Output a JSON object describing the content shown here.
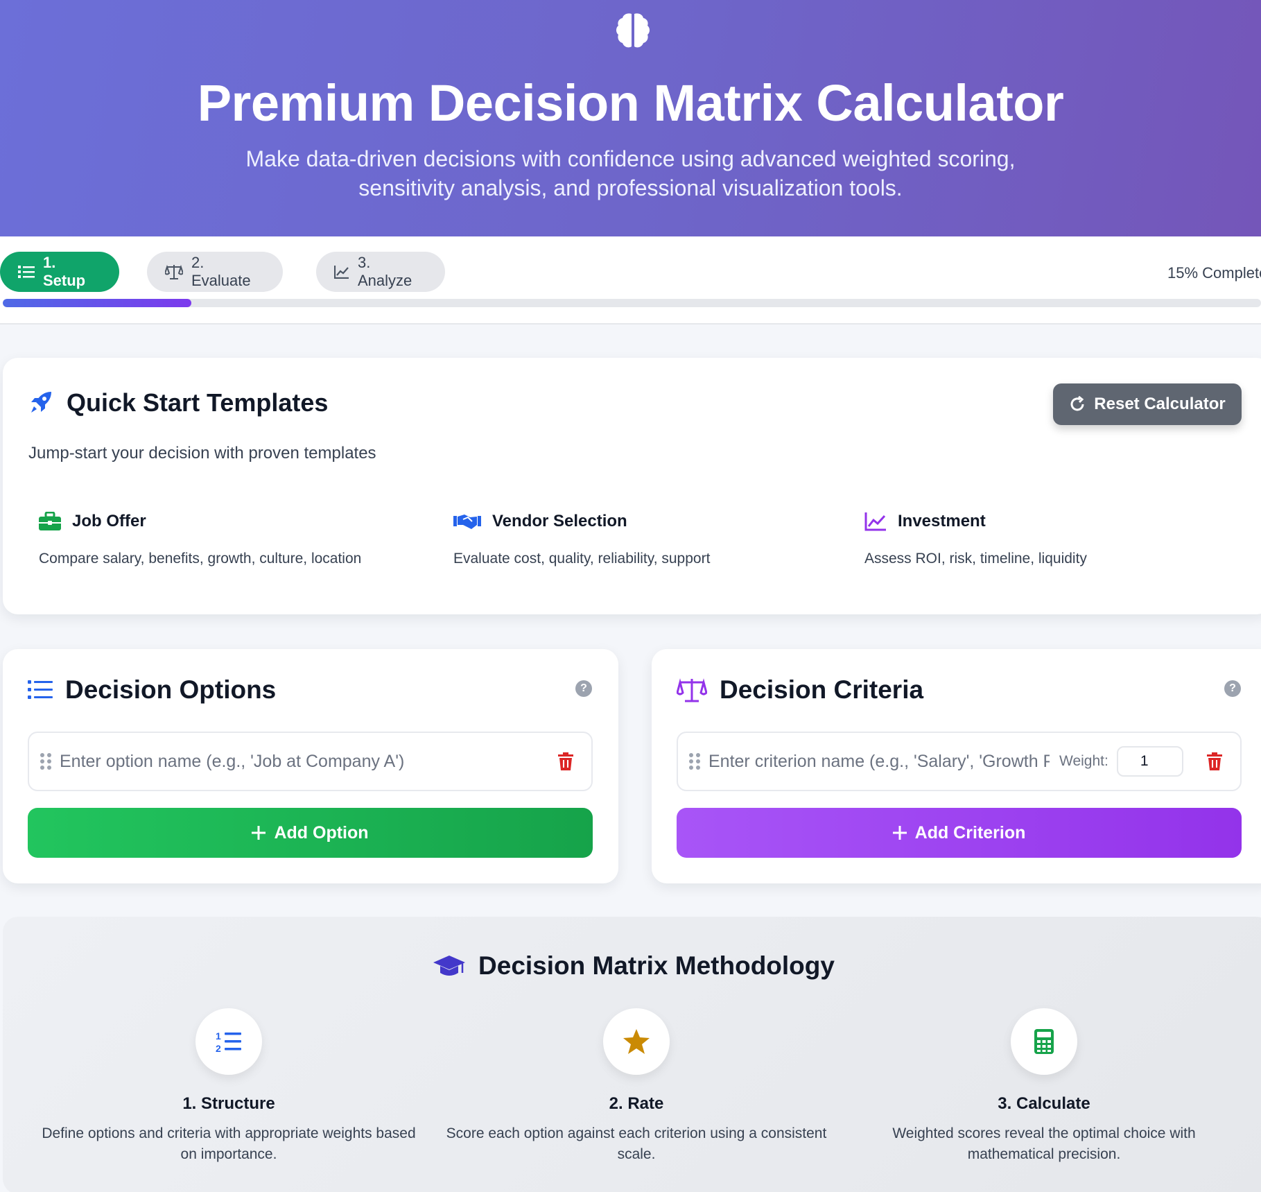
{
  "header": {
    "title": "Premium Decision Matrix Calculator",
    "subtitle": "Make data-driven decisions with confidence using advanced weighted scoring, sensitivity analysis, and professional visualization tools.",
    "icon": "brain-icon"
  },
  "steps": {
    "items": [
      {
        "label": "1. Setup",
        "icon": "list-icon",
        "active": true
      },
      {
        "label": "2. Evaluate",
        "icon": "scale-icon",
        "active": false
      },
      {
        "label": "3. Analyze",
        "icon": "chart-line-icon",
        "active": false
      }
    ],
    "progress_text": "15% Complete",
    "progress": 0.15
  },
  "quick_start": {
    "title": "Quick Start Templates",
    "subtitle": "Jump-start your decision with proven templates",
    "reset_label": "Reset Calculator",
    "templates": [
      {
        "title": "Job Offer",
        "desc": "Compare salary, benefits, growth, culture, location",
        "icon": "briefcase-icon",
        "color": "#16a34a"
      },
      {
        "title": "Vendor Selection",
        "desc": "Evaluate cost, quality, reliability, support",
        "icon": "handshake-icon",
        "color": "#2563eb"
      },
      {
        "title": "Investment",
        "desc": "Assess ROI, risk, timeline, liquidity",
        "icon": "chart-line-icon",
        "color": "#9333ea"
      }
    ]
  },
  "options": {
    "title": "Decision Options",
    "placeholder": "Enter option name (e.g., 'Job at Company A')",
    "value": "",
    "add_label": "Add Option"
  },
  "criteria": {
    "title": "Decision Criteria",
    "placeholder": "Enter criterion name (e.g., 'Salary', 'Growth Potential')",
    "value": "",
    "weight_label": "Weight:",
    "weight_value": "1",
    "add_label": "Add Criterion"
  },
  "methodology": {
    "title": "Decision Matrix Methodology",
    "steps": [
      {
        "title": "1. Structure",
        "desc": "Define options and criteria with appropriate weights based on importance.",
        "icon": "list-ol-icon"
      },
      {
        "title": "2. Rate",
        "desc": "Score each option against each criterion using a consistent scale.",
        "icon": "star-icon"
      },
      {
        "title": "3. Calculate",
        "desc": "Weighted scores reveal the optimal choice with mathematical precision.",
        "icon": "calculator-icon"
      }
    ]
  },
  "colors": {
    "header_gradient_start": "#6c6fd8",
    "header_gradient_end": "#7456b9",
    "active_step": "#10a46a",
    "add_option": "#16a34a",
    "add_criterion": "#9333ea",
    "reset_button": "#5f6671",
    "trash": "#dc2626"
  }
}
